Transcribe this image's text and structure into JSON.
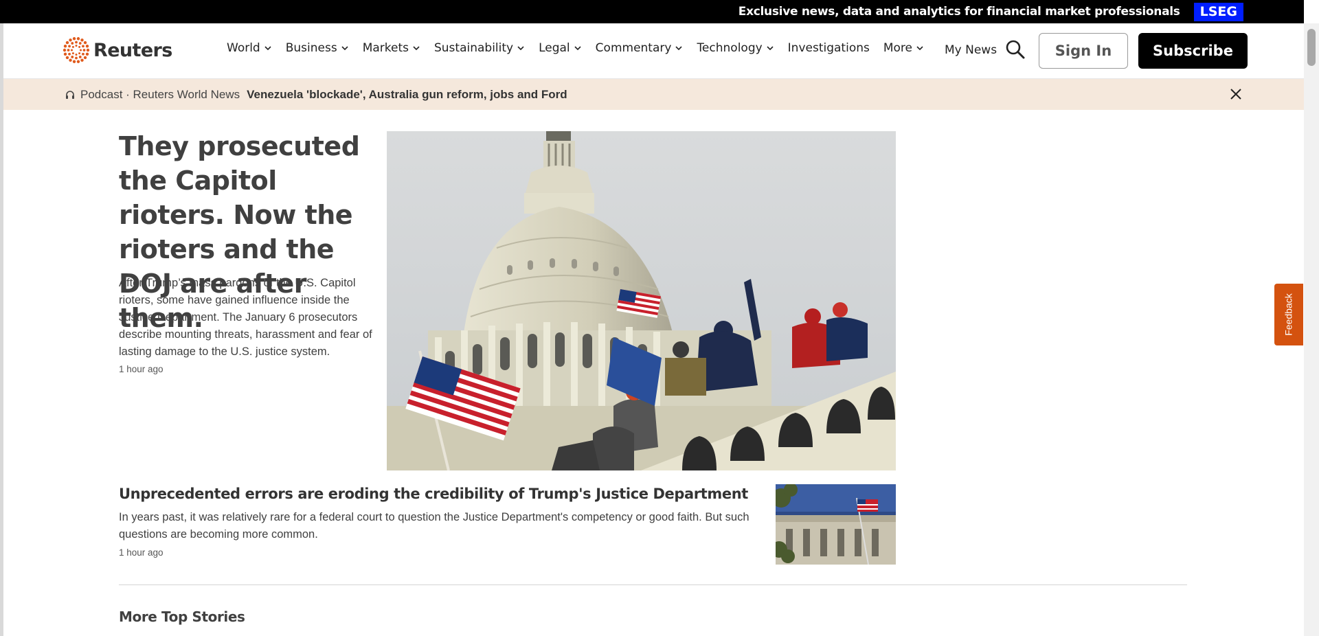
{
  "topbar": {
    "promo_text": "Exclusive news, data and analytics for financial market professionals",
    "lseg_label": "LSEG"
  },
  "header": {
    "logo_text": "Reuters",
    "nav": [
      {
        "label": "World",
        "dropdown": true
      },
      {
        "label": "Business",
        "dropdown": true
      },
      {
        "label": "Markets",
        "dropdown": true
      },
      {
        "label": "Sustainability",
        "dropdown": true
      },
      {
        "label": "Legal",
        "dropdown": true
      },
      {
        "label": "Commentary",
        "dropdown": true
      },
      {
        "label": "Technology",
        "dropdown": true
      },
      {
        "label": "Investigations",
        "dropdown": false
      },
      {
        "label": "More",
        "dropdown": true
      }
    ],
    "my_news_label": "My News",
    "sign_in_label": "Sign In",
    "subscribe_label": "Subscribe"
  },
  "podcast_bar": {
    "source": "Podcast · Reuters World News",
    "title": "Venezuela 'blockade', Australia gun reform, jobs and Ford",
    "icon": "headphones-icon"
  },
  "lead_story": {
    "title": "They prosecuted the Capitol rioters. Now the rioters and the DOJ are after them.",
    "description": "After Trump’s mass pardons of the U.S. Capitol rioters, some have gained influence inside the Justice Department. The January 6 prosecutors describe mounting threats, harassment and fear of lasting damage to the U.S. justice system.",
    "time": "1 hour ago"
  },
  "second_story": {
    "title": "Unprecedented errors are eroding the credibility of Trump's Justice Department",
    "description": "In years past, it was relatively rare for a federal court to question the Justice Department's competency or good faith. But such questions are becoming more common.",
    "time": "1 hour ago"
  },
  "section_heading": "More Top Stories",
  "feedback_label": "Feedback",
  "colors": {
    "podcast_bg": "#f5e8dc",
    "lseg_blue": "#001eff",
    "feedback_orange": "#d4520f",
    "logo_orange": "#e05a1c"
  }
}
